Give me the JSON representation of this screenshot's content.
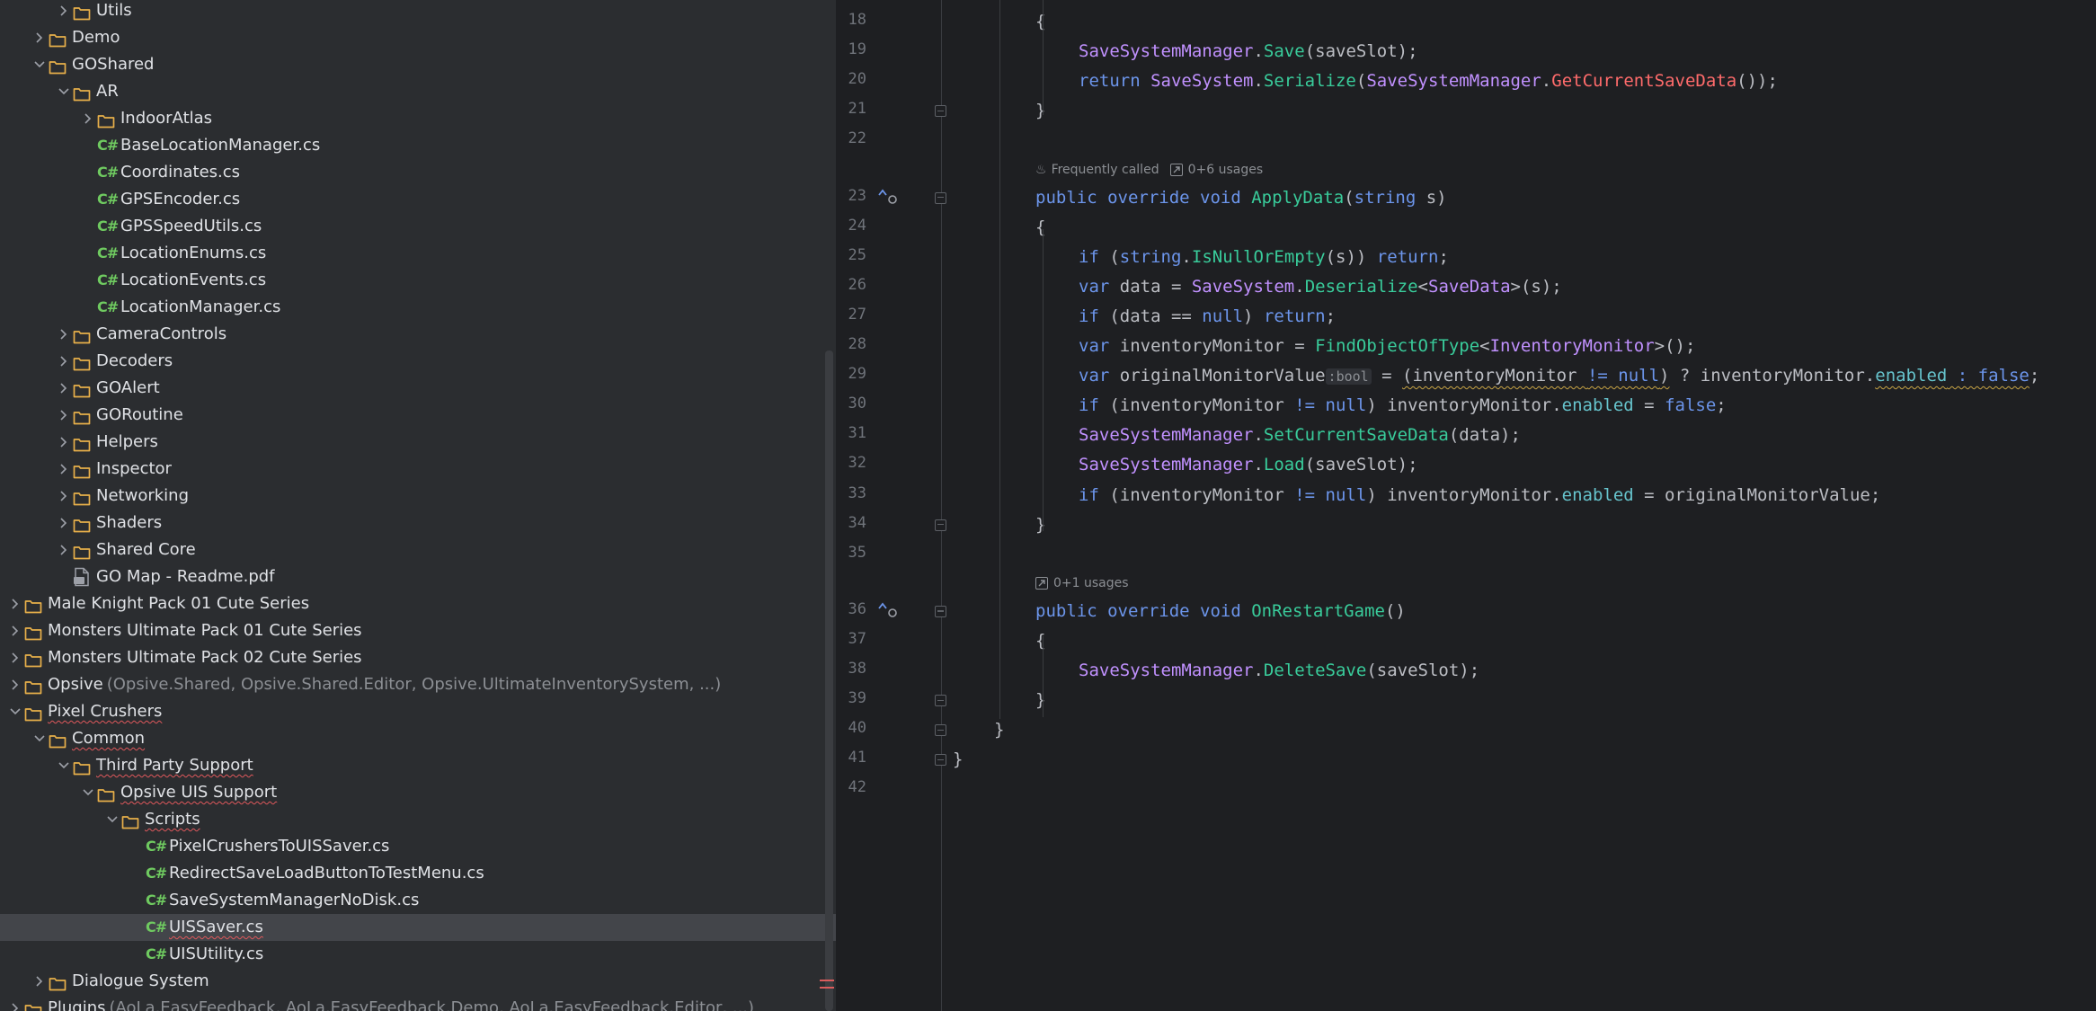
{
  "tree": {
    "items": [
      {
        "depth": 2,
        "expand": "collapsed",
        "icon": "folder",
        "label": "Utils"
      },
      {
        "depth": 1,
        "expand": "collapsed",
        "icon": "folder",
        "label": "Demo"
      },
      {
        "depth": 1,
        "expand": "expanded",
        "icon": "folder",
        "label": "GOShared"
      },
      {
        "depth": 2,
        "expand": "expanded",
        "icon": "folder",
        "label": "AR"
      },
      {
        "depth": 3,
        "expand": "collapsed",
        "icon": "folder",
        "label": "IndoorAtlas"
      },
      {
        "depth": 3,
        "expand": "none",
        "icon": "csharp",
        "label": "BaseLocationManager.cs"
      },
      {
        "depth": 3,
        "expand": "none",
        "icon": "csharp",
        "label": "Coordinates.cs"
      },
      {
        "depth": 3,
        "expand": "none",
        "icon": "csharp",
        "label": "GPSEncoder.cs"
      },
      {
        "depth": 3,
        "expand": "none",
        "icon": "csharp",
        "label": "GPSSpeedUtils.cs"
      },
      {
        "depth": 3,
        "expand": "none",
        "icon": "csharp",
        "label": "LocationEnums.cs"
      },
      {
        "depth": 3,
        "expand": "none",
        "icon": "csharp",
        "label": "LocationEvents.cs"
      },
      {
        "depth": 3,
        "expand": "none",
        "icon": "csharp",
        "label": "LocationManager.cs"
      },
      {
        "depth": 2,
        "expand": "collapsed",
        "icon": "folder",
        "label": "CameraControls"
      },
      {
        "depth": 2,
        "expand": "collapsed",
        "icon": "folder",
        "label": "Decoders"
      },
      {
        "depth": 2,
        "expand": "collapsed",
        "icon": "folder",
        "label": "GOAlert"
      },
      {
        "depth": 2,
        "expand": "collapsed",
        "icon": "folder",
        "label": "GORoutine"
      },
      {
        "depth": 2,
        "expand": "collapsed",
        "icon": "folder",
        "label": "Helpers"
      },
      {
        "depth": 2,
        "expand": "collapsed",
        "icon": "folder",
        "label": "Inspector"
      },
      {
        "depth": 2,
        "expand": "collapsed",
        "icon": "folder",
        "label": "Networking"
      },
      {
        "depth": 2,
        "expand": "collapsed",
        "icon": "folder",
        "label": "Shaders"
      },
      {
        "depth": 2,
        "expand": "collapsed",
        "icon": "folder",
        "label": "Shared Core"
      },
      {
        "depth": 2,
        "expand": "none",
        "icon": "pdf",
        "label": "GO Map - Readme.pdf"
      },
      {
        "depth": 0,
        "expand": "collapsed",
        "icon": "folder",
        "label": "Male Knight Pack 01 Cute Series"
      },
      {
        "depth": 0,
        "expand": "collapsed",
        "icon": "folder",
        "label": "Monsters Ultimate Pack 01 Cute Series"
      },
      {
        "depth": 0,
        "expand": "collapsed",
        "icon": "folder",
        "label": "Monsters Ultimate Pack 02 Cute Series"
      },
      {
        "depth": 0,
        "expand": "collapsed",
        "icon": "folder",
        "label": "Opsive",
        "suffix": "(Opsive.Shared, Opsive.Shared.Editor, Opsive.UltimateInventorySystem, ...)"
      },
      {
        "depth": 0,
        "expand": "expanded",
        "icon": "folder",
        "label": "Pixel Crushers",
        "squiggle": true
      },
      {
        "depth": 1,
        "expand": "expanded",
        "icon": "folder",
        "label": "Common",
        "squiggle": true
      },
      {
        "depth": 2,
        "expand": "expanded",
        "icon": "folder",
        "label": "Third Party Support",
        "squiggle": true
      },
      {
        "depth": 3,
        "expand": "expanded",
        "icon": "folder",
        "label": "Opsive UIS Support",
        "squiggle": true
      },
      {
        "depth": 4,
        "expand": "expanded",
        "icon": "folder",
        "label": "Scripts",
        "squiggle": true
      },
      {
        "depth": 5,
        "expand": "none",
        "icon": "csharp",
        "label": "PixelCrushersToUISSaver.cs"
      },
      {
        "depth": 5,
        "expand": "none",
        "icon": "csharp",
        "label": "RedirectSaveLoadButtonToTestMenu.cs"
      },
      {
        "depth": 5,
        "expand": "none",
        "icon": "csharp",
        "label": "SaveSystemManagerNoDisk.cs"
      },
      {
        "depth": 5,
        "expand": "none",
        "icon": "csharp",
        "label": "UISSaver.cs",
        "selected": true,
        "squiggle": true
      },
      {
        "depth": 5,
        "expand": "none",
        "icon": "csharp",
        "label": "UISUtility.cs"
      },
      {
        "depth": 1,
        "expand": "collapsed",
        "icon": "folder",
        "label": "Dialogue System"
      },
      {
        "depth": 0,
        "expand": "collapsed",
        "icon": "folder",
        "label": "Plugins",
        "suffix": "(AoLa.EasyFeedback, AoLa.EasyFeedback.Demo, AoLa.EasyFeedback.Editor, ...)"
      }
    ]
  },
  "csharp_icon_text": "C#",
  "editor": {
    "lines": [
      {
        "n": "18",
        "indent": 2,
        "tokens": [
          [
            "p",
            "{"
          ]
        ]
      },
      {
        "n": "19",
        "indent": 3,
        "tokens": [
          [
            "typ",
            "SaveSystemManager"
          ],
          [
            "p",
            "."
          ],
          [
            "mth",
            "Save"
          ],
          [
            "p",
            "("
          ],
          [
            "var",
            "saveSlot"
          ],
          [
            "p",
            ");"
          ]
        ]
      },
      {
        "n": "20",
        "indent": 3,
        "tokens": [
          [
            "kwb",
            "return "
          ],
          [
            "typ",
            "SaveSystem"
          ],
          [
            "p",
            "."
          ],
          [
            "mth",
            "Serialize"
          ],
          [
            "p",
            "("
          ],
          [
            "typ",
            "SaveSystemManager"
          ],
          [
            "p",
            "."
          ],
          [
            "red",
            "GetCurrentSaveData"
          ],
          [
            "p",
            "());"
          ]
        ]
      },
      {
        "n": "21",
        "indent": 2,
        "fold": true,
        "tokens": [
          [
            "p",
            "}"
          ]
        ]
      },
      {
        "n": "22",
        "indent": 0,
        "tokens": []
      },
      {
        "hint": true,
        "items": [
          {
            "icon": "fire",
            "text": "Frequently called"
          },
          {
            "icon": "usages",
            "text": "0+6 usages"
          }
        ]
      },
      {
        "n": "23",
        "indent": 2,
        "fold": true,
        "override": true,
        "tokens": [
          [
            "kwb",
            "public "
          ],
          [
            "kwb",
            "override "
          ],
          [
            "kwb",
            "void "
          ],
          [
            "mth",
            "ApplyData"
          ],
          [
            "p",
            "("
          ],
          [
            "kwb",
            "string "
          ],
          [
            "var",
            "s"
          ],
          [
            "p",
            ")"
          ]
        ]
      },
      {
        "n": "24",
        "indent": 2,
        "tokens": [
          [
            "p",
            "{"
          ]
        ]
      },
      {
        "n": "25",
        "indent": 3,
        "tokens": [
          [
            "kwb",
            "if "
          ],
          [
            "p",
            "("
          ],
          [
            "kwb",
            "string"
          ],
          [
            "p",
            "."
          ],
          [
            "mth",
            "IsNullOrEmpty"
          ],
          [
            "p",
            "(s)) "
          ],
          [
            "kwb",
            "return"
          ],
          [
            "p",
            ";"
          ]
        ]
      },
      {
        "n": "26",
        "indent": 3,
        "tokens": [
          [
            "kwb",
            "var "
          ],
          [
            "var",
            "data"
          ],
          [
            "p",
            " = "
          ],
          [
            "typ",
            "SaveSystem"
          ],
          [
            "p",
            "."
          ],
          [
            "mth",
            "Deserialize"
          ],
          [
            "p",
            "<"
          ],
          [
            "typ",
            "SaveData"
          ],
          [
            "p",
            ">(s);"
          ]
        ]
      },
      {
        "n": "27",
        "indent": 3,
        "tokens": [
          [
            "kwb",
            "if "
          ],
          [
            "p",
            "(data == "
          ],
          [
            "kwb",
            "null"
          ],
          [
            "p",
            ") "
          ],
          [
            "kwb",
            "return"
          ],
          [
            "p",
            ";"
          ]
        ]
      },
      {
        "n": "28",
        "indent": 3,
        "tokens": [
          [
            "kwb",
            "var "
          ],
          [
            "var",
            "inventoryMonitor"
          ],
          [
            "p",
            " = "
          ],
          [
            "mth",
            "FindObjectOfType"
          ],
          [
            "p",
            "<"
          ],
          [
            "typ",
            "InventoryMonitor"
          ],
          [
            "p",
            ">();"
          ]
        ]
      },
      {
        "n": "29",
        "indent": 3,
        "tokens": [
          [
            "kwb",
            "var "
          ],
          [
            "var",
            "originalMonitorValue"
          ],
          [
            "inlay",
            ":bool"
          ],
          [
            "p",
            " = "
          ],
          [
            "warn",
            "(inventoryMonitor "
          ],
          [
            "warnkw",
            "!= null"
          ],
          [
            "warn",
            ")"
          ],
          [
            "p",
            " ? inventoryMonitor."
          ],
          [
            "fldw",
            "enabled"
          ],
          [
            "warnkw",
            " : false"
          ],
          [
            "p",
            ";"
          ]
        ]
      },
      {
        "n": "30",
        "indent": 3,
        "tokens": [
          [
            "kwb",
            "if "
          ],
          [
            "p",
            "(inventoryMonitor "
          ],
          [
            "kwb",
            "!= null"
          ],
          [
            "p",
            ") inventoryMonitor."
          ],
          [
            "fld",
            "enabled"
          ],
          [
            "p",
            " = "
          ],
          [
            "kwb",
            "false"
          ],
          [
            "p",
            ";"
          ]
        ]
      },
      {
        "n": "31",
        "indent": 3,
        "tokens": [
          [
            "typ",
            "SaveSystemManager"
          ],
          [
            "p",
            "."
          ],
          [
            "mth",
            "SetCurrentSaveData"
          ],
          [
            "p",
            "(data);"
          ]
        ]
      },
      {
        "n": "32",
        "indent": 3,
        "tokens": [
          [
            "typ",
            "SaveSystemManager"
          ],
          [
            "p",
            "."
          ],
          [
            "mth",
            "Load"
          ],
          [
            "p",
            "("
          ],
          [
            "var",
            "saveSlot"
          ],
          [
            "p",
            ");"
          ]
        ]
      },
      {
        "n": "33",
        "indent": 3,
        "tokens": [
          [
            "kwb",
            "if "
          ],
          [
            "p",
            "(inventoryMonitor "
          ],
          [
            "kwb",
            "!= null"
          ],
          [
            "p",
            ") inventoryMonitor."
          ],
          [
            "fld",
            "enabled"
          ],
          [
            "p",
            " = originalMonitorValue;"
          ]
        ]
      },
      {
        "n": "34",
        "indent": 2,
        "fold": true,
        "tokens": [
          [
            "p",
            "}"
          ]
        ]
      },
      {
        "n": "35",
        "indent": 0,
        "tokens": []
      },
      {
        "hint": true,
        "items": [
          {
            "icon": "usages",
            "text": "0+1 usages"
          }
        ]
      },
      {
        "n": "36",
        "indent": 2,
        "fold": true,
        "override": true,
        "tokens": [
          [
            "kwb",
            "public "
          ],
          [
            "kwb",
            "override "
          ],
          [
            "kwb",
            "void "
          ],
          [
            "mth",
            "OnRestartGame"
          ],
          [
            "p",
            "()"
          ]
        ]
      },
      {
        "n": "37",
        "indent": 2,
        "tokens": [
          [
            "p",
            "{"
          ]
        ]
      },
      {
        "n": "38",
        "indent": 3,
        "tokens": [
          [
            "typ",
            "SaveSystemManager"
          ],
          [
            "p",
            "."
          ],
          [
            "mth",
            "DeleteSave"
          ],
          [
            "p",
            "("
          ],
          [
            "var",
            "saveSlot"
          ],
          [
            "p",
            ");"
          ]
        ]
      },
      {
        "n": "39",
        "indent": 2,
        "fold": true,
        "tokens": [
          [
            "p",
            "}"
          ]
        ]
      },
      {
        "n": "40",
        "indent": 1,
        "fold": true,
        "tokens": [
          [
            "p",
            "}"
          ]
        ]
      },
      {
        "n": "41",
        "indent": 0,
        "fold": true,
        "tokens": [
          [
            "p",
            "}"
          ]
        ]
      },
      {
        "n": "42",
        "indent": 0,
        "tokens": []
      }
    ]
  },
  "colors": {
    "tree_bg": "#2b2d30",
    "editor_bg": "#1e1f22",
    "selection": "#43454a",
    "folder": "#e8b04a",
    "csharp": "#6fca60",
    "keyword": "#6c95eb",
    "type": "#c191ff",
    "method": "#39cc9b",
    "field": "#66c3cc",
    "error": "#ff6b6b"
  }
}
